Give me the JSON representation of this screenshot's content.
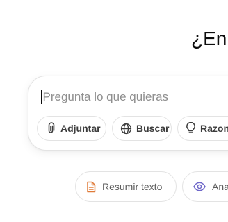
{
  "heading": "¿En",
  "composer": {
    "placeholder": "Pregunta lo que quieras",
    "tools": [
      {
        "label": "Adjuntar",
        "icon": "paperclip-icon"
      },
      {
        "label": "Buscar",
        "icon": "globe-icon"
      },
      {
        "label": "Razona",
        "icon": "lightbulb-icon"
      }
    ]
  },
  "suggestions": [
    {
      "label": "Resumir texto",
      "icon": "document-icon",
      "color": "#e07b39"
    },
    {
      "label": "Ana",
      "icon": "eye-icon",
      "color": "#6e67c9"
    }
  ]
}
